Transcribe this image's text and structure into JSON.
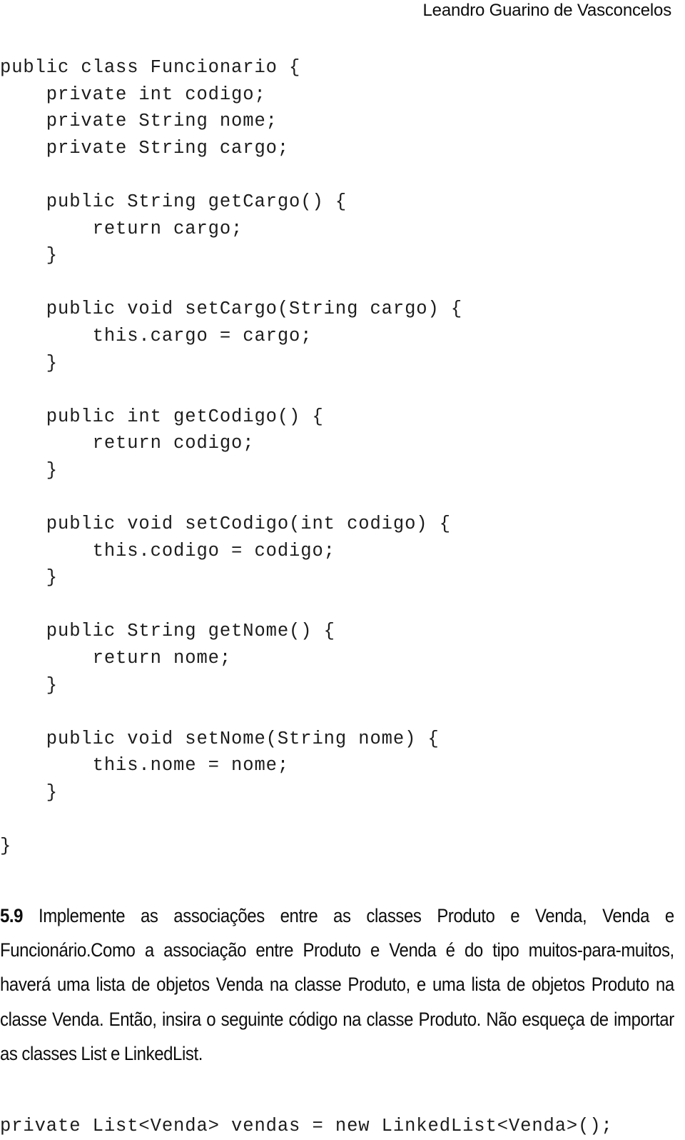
{
  "header": {
    "author": "Leandro Guarino de Vasconcelos"
  },
  "code_block": {
    "language": "java",
    "lines": [
      "public class Funcionario {",
      "    private int codigo;",
      "    private String nome;",
      "    private String cargo;",
      "",
      "    public String getCargo() {",
      "        return cargo;",
      "    }",
      "",
      "    public void setCargo(String cargo) {",
      "        this.cargo = cargo;",
      "    }",
      "",
      "    public int getCodigo() {",
      "        return codigo;",
      "    }",
      "",
      "    public void setCodigo(int codigo) {",
      "        this.codigo = codigo;",
      "    }",
      "",
      "    public String getNome() {",
      "        return nome;",
      "    }",
      "",
      "    public void setNome(String nome) {",
      "        this.nome = nome;",
      "    }",
      "",
      "}"
    ]
  },
  "exercise": {
    "number": "5.9",
    "title": " Implemente as associações entre as classes Produto e Venda, Venda e Funcionário.",
    "paragraph": "Como a associação entre Produto e Venda é do tipo muitos-para-muitos, haverá uma lista de objetos Venda na classe Produto, e uma lista de objetos Produto na classe Venda. Então, insira o seguinte código na classe Produto. Não esqueça de importar as classes List e LinkedList."
  },
  "code_tail": {
    "line": "private List<Venda> vendas = new LinkedList<Venda>();"
  }
}
